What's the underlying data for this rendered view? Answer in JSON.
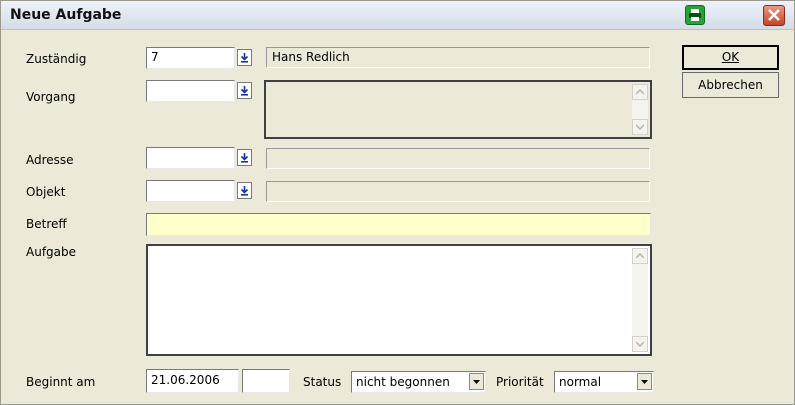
{
  "window": {
    "title": "Neue Aufgabe"
  },
  "titlebar": {
    "print_icon": "printer-icon",
    "close_icon": "close-icon"
  },
  "form": {
    "zustaendig_label": "Zuständig",
    "zustaendig_value": "7",
    "zustaendig_name": "Hans Redlich",
    "vorgang_label": "Vorgang",
    "vorgang_value": "",
    "adresse_label": "Adresse",
    "adresse_value": "",
    "objekt_label": "Objekt",
    "objekt_value": "",
    "betreff_label": "Betreff",
    "betreff_value": "",
    "aufgabe_label": "Aufgabe",
    "aufgabe_value": "",
    "beginnt_label": "Beginnt am",
    "beginnt_date": "21.06.2006",
    "beginnt_time": "",
    "status_label": "Status",
    "status_value": "nicht begonnen",
    "prioritaet_label": "Priorität",
    "prioritaet_value": "normal"
  },
  "buttons": {
    "ok": "OK",
    "cancel": "Abbrechen"
  },
  "colors": {
    "subject_bg": "#ffffcc",
    "window_bg": "#ece9d8",
    "close_red": "#c4432a",
    "print_green": "#26a336"
  }
}
